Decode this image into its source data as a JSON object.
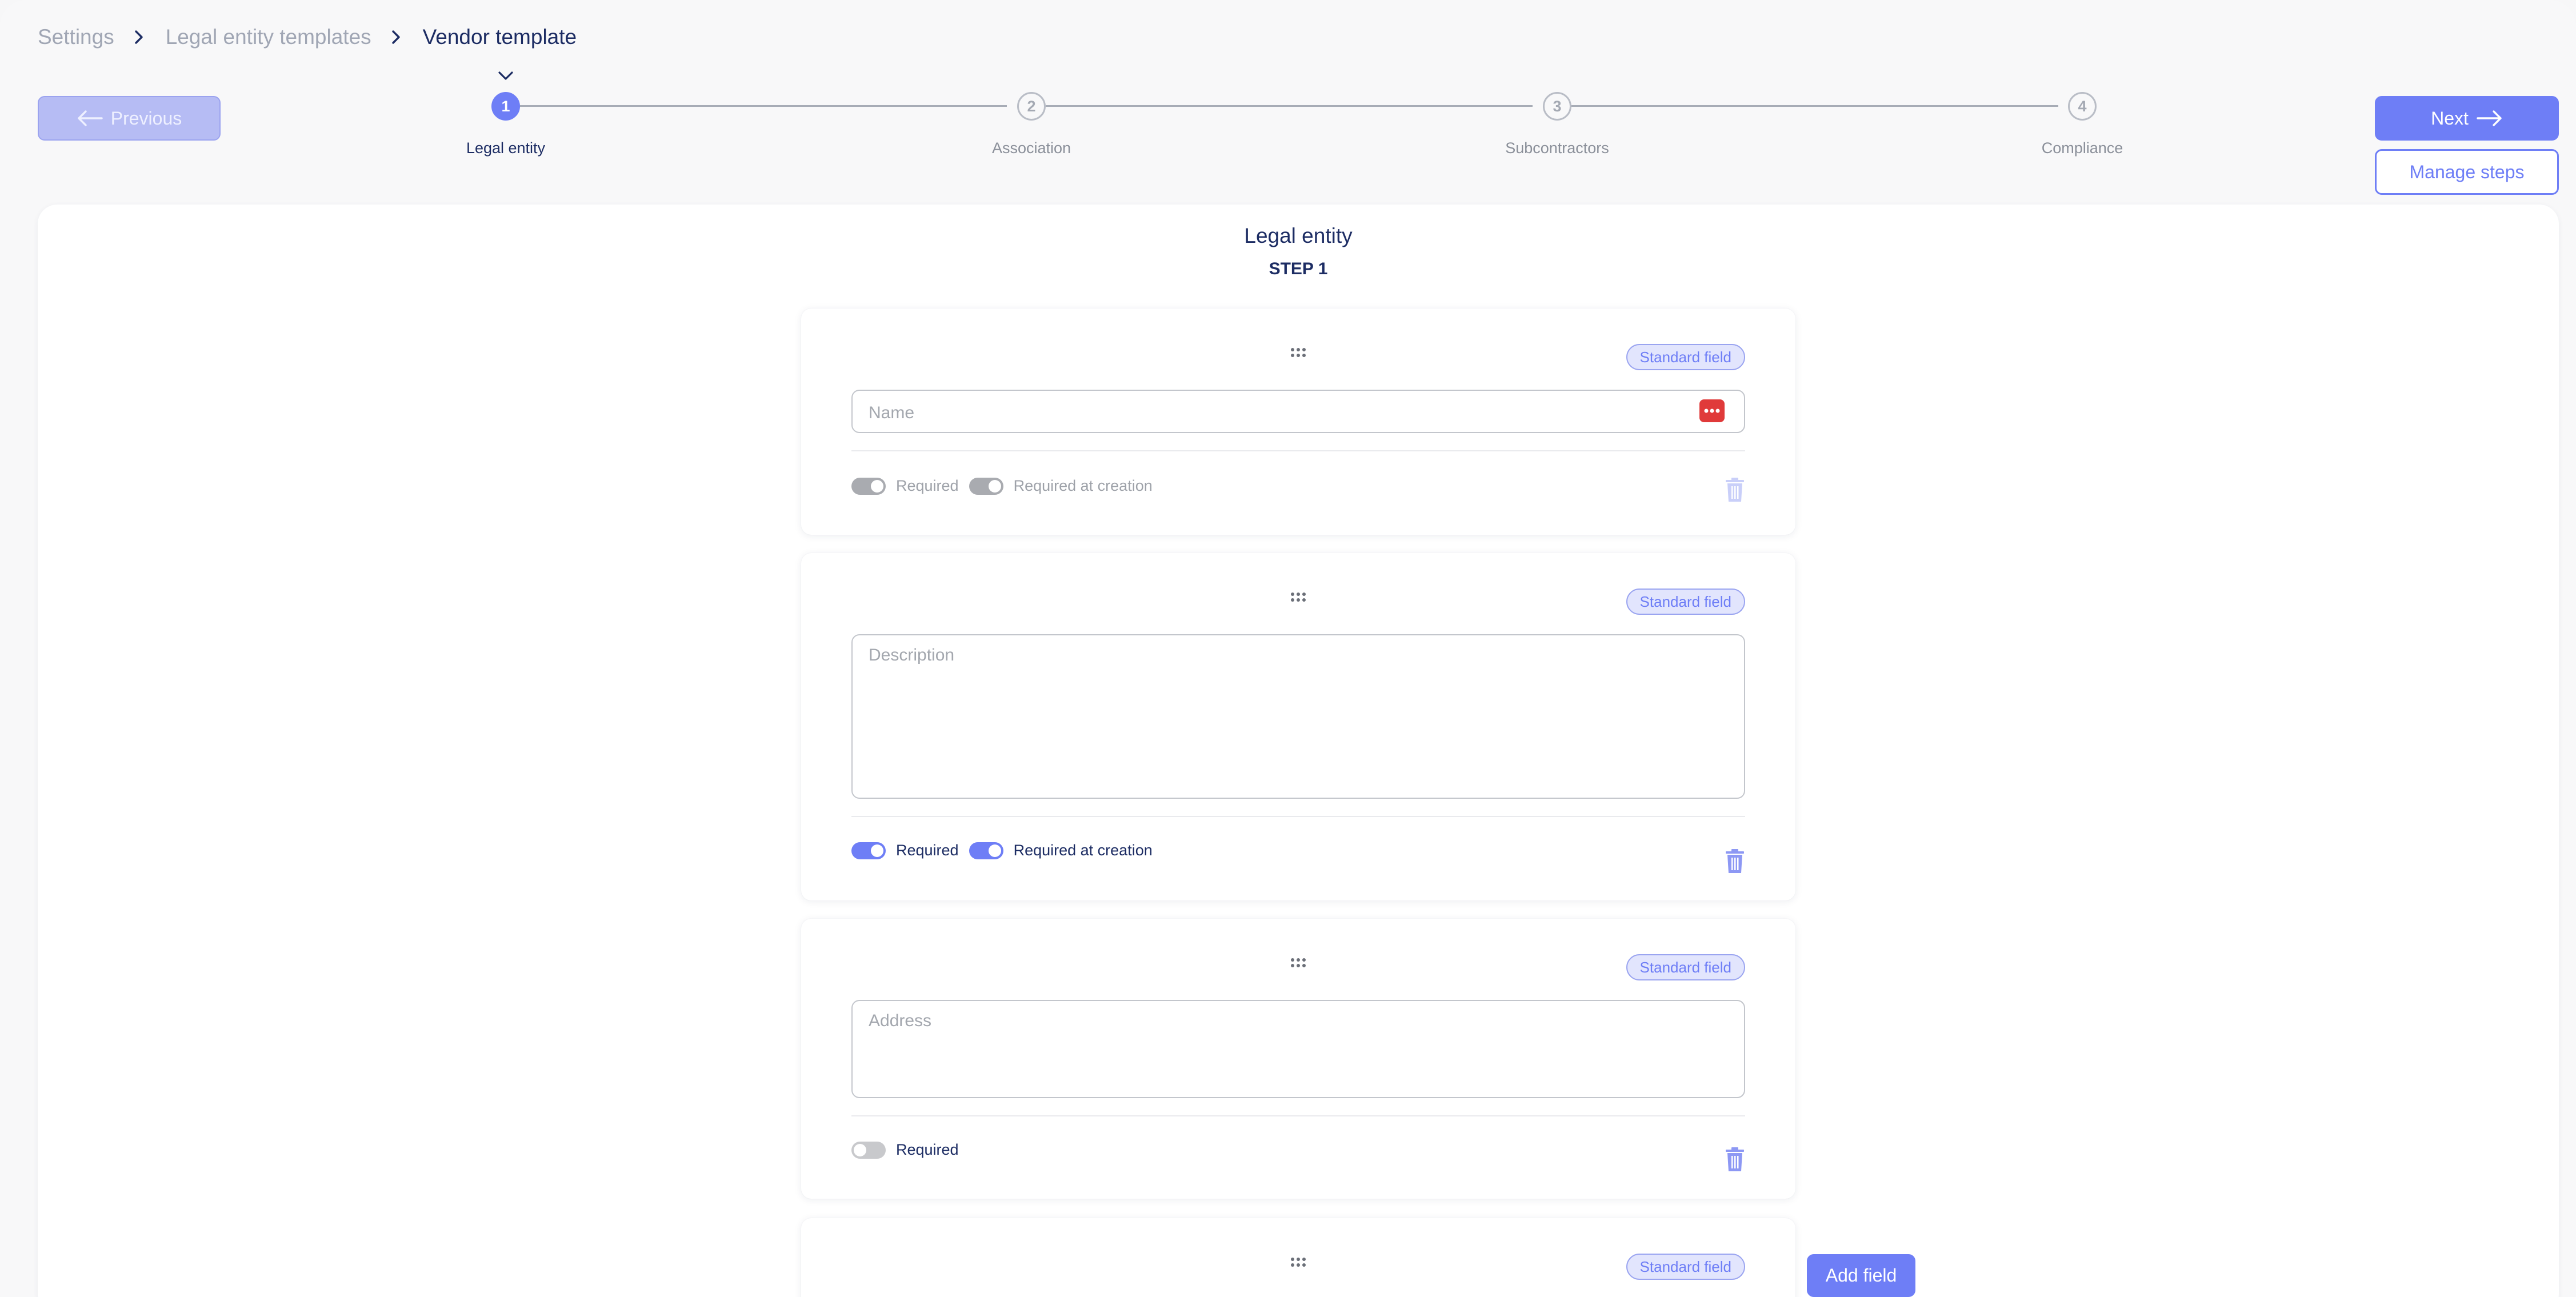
{
  "breadcrumb": {
    "items": [
      "Settings",
      "Legal entity templates"
    ],
    "current": "Vendor template"
  },
  "nav": {
    "previous_label": "Previous",
    "next_label": "Next",
    "manage_steps_label": "Manage steps",
    "add_field_label": "Add field"
  },
  "stepper": {
    "active_step": 1,
    "steps": [
      {
        "number": "1",
        "label": "Legal entity"
      },
      {
        "number": "2",
        "label": "Association"
      },
      {
        "number": "3",
        "label": "Subcontractors"
      },
      {
        "number": "4",
        "label": "Compliance"
      }
    ]
  },
  "main": {
    "title": "Legal entity",
    "subtitle": "STEP 1"
  },
  "fields": [
    {
      "badge": "Standard field",
      "placeholder": "Name",
      "toggles": [
        {
          "label": "Required",
          "on": true,
          "state": "disabled"
        },
        {
          "label": "Required at creation",
          "on": true,
          "state": "disabled"
        }
      ]
    },
    {
      "badge": "Standard field",
      "placeholder": "Description",
      "toggles": [
        {
          "label": "Required",
          "on": true,
          "state": "enabled"
        },
        {
          "label": "Required at creation",
          "on": true,
          "state": "enabled"
        }
      ]
    },
    {
      "badge": "Standard field",
      "placeholder": "Address",
      "toggles": [
        {
          "label": "Required",
          "on": false,
          "state": "enabled"
        }
      ]
    },
    {
      "badge": "Standard field"
    }
  ],
  "colors": {
    "accent": "#6e7ef6",
    "accent_light": "#b6bcf4",
    "text_dark": "#1c2c63",
    "text_muted": "#a0a6b4",
    "danger_icon": "#e03a3a"
  },
  "icons": {
    "breadcrumb_separator": "chevron-right-icon",
    "step_indicator": "chevron-down-icon",
    "drag": "drag-handle-icon",
    "delete": "trash-icon",
    "password_manager": "more-dots-icon",
    "prev_arrow": "arrow-left-icon",
    "next_arrow": "arrow-right-icon"
  }
}
